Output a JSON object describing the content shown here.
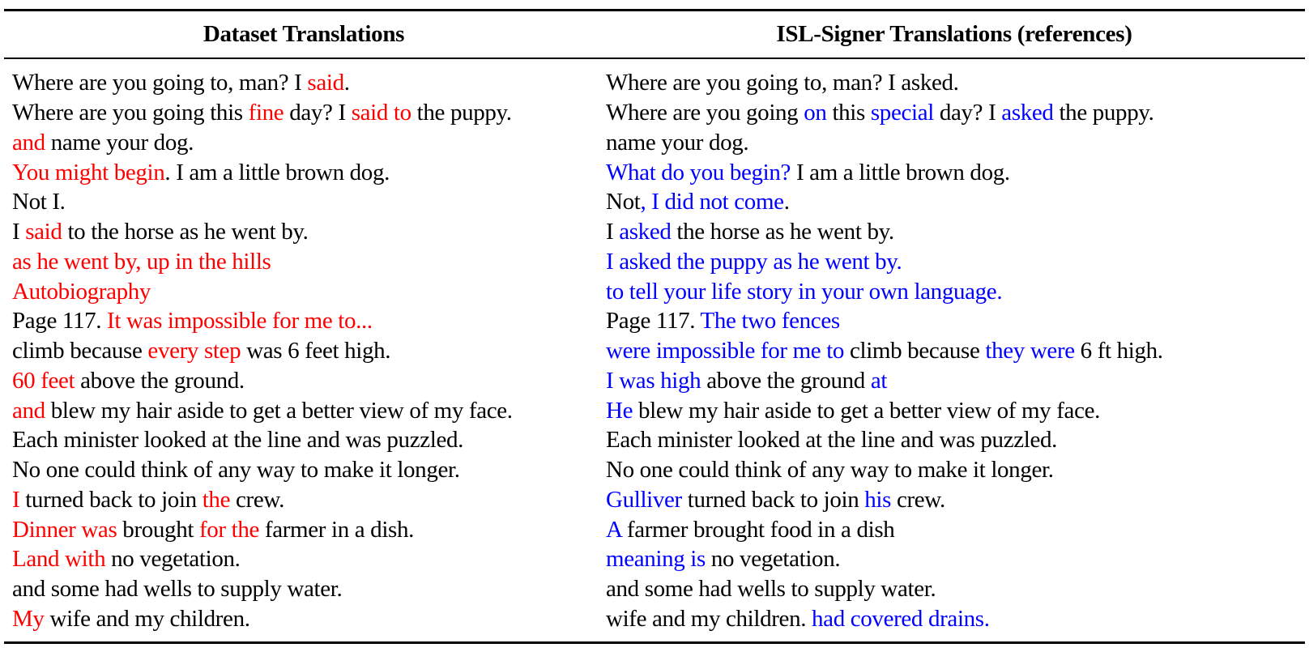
{
  "colors": {
    "dataset_highlight": "#ff0000",
    "reference_highlight": "#0000ff",
    "text": "#000000"
  },
  "table": {
    "headers": {
      "left": "Dataset Translations",
      "right": "ISL-Signer Translations (references)"
    },
    "rows": [
      {
        "left": [
          {
            "t": "Where are you going to, man? I ",
            "h": false
          },
          {
            "t": "said",
            "h": true
          },
          {
            "t": ".",
            "h": false
          }
        ],
        "right": [
          {
            "t": "Where are you going to, man? I asked.",
            "h": false
          }
        ]
      },
      {
        "left": [
          {
            "t": "Where are you going this ",
            "h": false
          },
          {
            "t": "fine",
            "h": true
          },
          {
            "t": " day? I ",
            "h": false
          },
          {
            "t": "said to",
            "h": true
          },
          {
            "t": " the puppy.",
            "h": false
          }
        ],
        "right": [
          {
            "t": "Where are you going ",
            "h": false
          },
          {
            "t": "on",
            "h": true
          },
          {
            "t": " this ",
            "h": false
          },
          {
            "t": "special",
            "h": true
          },
          {
            "t": " day? I ",
            "h": false
          },
          {
            "t": "asked",
            "h": true
          },
          {
            "t": " the puppy.",
            "h": false
          }
        ]
      },
      {
        "left": [
          {
            "t": "and",
            "h": true
          },
          {
            "t": " name your dog.",
            "h": false
          }
        ],
        "right": [
          {
            "t": "name your dog.",
            "h": false
          }
        ]
      },
      {
        "left": [
          {
            "t": "You might begin",
            "h": true
          },
          {
            "t": ". I am a little brown dog.",
            "h": false
          }
        ],
        "right": [
          {
            "t": "What do you begin?",
            "h": true
          },
          {
            "t": " I am a little brown dog.",
            "h": false
          }
        ]
      },
      {
        "left": [
          {
            "t": "Not I.",
            "h": false
          }
        ],
        "right": [
          {
            "t": "Not",
            "h": false
          },
          {
            "t": ", I did not come",
            "h": true
          },
          {
            "t": ".",
            "h": false
          }
        ]
      },
      {
        "left": [
          {
            "t": "I ",
            "h": false
          },
          {
            "t": "said",
            "h": true
          },
          {
            "t": " to the horse as he went by.",
            "h": false
          }
        ],
        "right": [
          {
            "t": "I ",
            "h": false
          },
          {
            "t": "asked",
            "h": true
          },
          {
            "t": " the horse as he went by.",
            "h": false
          }
        ]
      },
      {
        "left": [
          {
            "t": "as he went by, up in the hills",
            "h": true
          }
        ],
        "right": [
          {
            "t": "I asked the puppy as he went by.",
            "h": true
          }
        ]
      },
      {
        "left": [
          {
            "t": "Autobiography",
            "h": true
          }
        ],
        "right": [
          {
            "t": "to tell your life story in your own language.",
            "h": true
          }
        ]
      },
      {
        "left": [
          {
            "t": "Page 117. ",
            "h": false
          },
          {
            "t": "It was impossible for me to...",
            "h": true
          }
        ],
        "right": [
          {
            "t": "Page 117. ",
            "h": false
          },
          {
            "t": "The two fences",
            "h": true
          }
        ]
      },
      {
        "left": [
          {
            "t": "climb because ",
            "h": false
          },
          {
            "t": "every step",
            "h": true
          },
          {
            "t": " was 6 feet high.",
            "h": false
          }
        ],
        "right": [
          {
            "t": "were impossible for me to",
            "h": true
          },
          {
            "t": " climb because ",
            "h": false
          },
          {
            "t": "they were",
            "h": true
          },
          {
            "t": " 6 ft high.",
            "h": false
          }
        ]
      },
      {
        "left": [
          {
            "t": "60 feet",
            "h": true
          },
          {
            "t": " above the ground.",
            "h": false
          }
        ],
        "right": [
          {
            "t": "I was high",
            "h": true
          },
          {
            "t": " above the ground ",
            "h": false
          },
          {
            "t": "at",
            "h": true
          }
        ]
      },
      {
        "left": [
          {
            "t": "and",
            "h": true
          },
          {
            "t": " blew my hair aside to get a better view of my face.",
            "h": false
          }
        ],
        "right": [
          {
            "t": "He",
            "h": true
          },
          {
            "t": " blew my hair aside to get a better view of my face.",
            "h": false
          }
        ]
      },
      {
        "left": [
          {
            "t": "Each minister looked at the line and was puzzled.",
            "h": false
          }
        ],
        "right": [
          {
            "t": "Each minister looked at the line and was puzzled.",
            "h": false
          }
        ]
      },
      {
        "left": [
          {
            "t": "No one could think of any way to make it longer.",
            "h": false
          }
        ],
        "right": [
          {
            "t": "No one could think of any way to make it longer.",
            "h": false
          }
        ]
      },
      {
        "left": [
          {
            "t": "I",
            "h": true
          },
          {
            "t": " turned back to join ",
            "h": false
          },
          {
            "t": "the",
            "h": true
          },
          {
            "t": " crew.",
            "h": false
          }
        ],
        "right": [
          {
            "t": "Gulliver",
            "h": true
          },
          {
            "t": " turned back to join ",
            "h": false
          },
          {
            "t": "his",
            "h": true
          },
          {
            "t": " crew.",
            "h": false
          }
        ]
      },
      {
        "left": [
          {
            "t": "Dinner was",
            "h": true
          },
          {
            "t": " brought ",
            "h": false
          },
          {
            "t": "for the",
            "h": true
          },
          {
            "t": " farmer in a dish.",
            "h": false
          }
        ],
        "right": [
          {
            "t": "A",
            "h": true
          },
          {
            "t": " farmer brought food in a dish",
            "h": false
          }
        ]
      },
      {
        "left": [
          {
            "t": "Land with",
            "h": true
          },
          {
            "t": " no vegetation.",
            "h": false
          }
        ],
        "right": [
          {
            "t": "meaning is",
            "h": true
          },
          {
            "t": " no vegetation.",
            "h": false
          }
        ]
      },
      {
        "left": [
          {
            "t": "and some had wells to supply water.",
            "h": false
          }
        ],
        "right": [
          {
            "t": "and some had wells to supply water.",
            "h": false
          }
        ]
      },
      {
        "left": [
          {
            "t": "My",
            "h": true
          },
          {
            "t": " wife and my children.",
            "h": false
          }
        ],
        "right": [
          {
            "t": "wife and my children. ",
            "h": false
          },
          {
            "t": "had covered drains.",
            "h": true
          }
        ]
      }
    ]
  }
}
